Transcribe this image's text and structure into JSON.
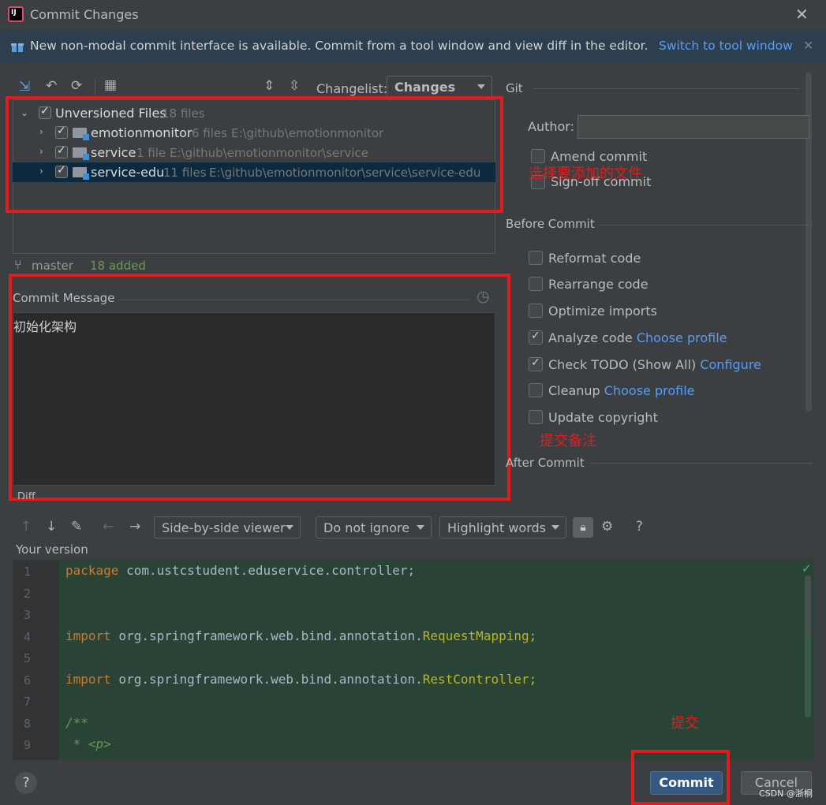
{
  "window": {
    "title": "Commit Changes"
  },
  "banner": {
    "text": "New non-modal commit interface is available. Commit from a tool window and view diff in the editor.",
    "link": "Switch to tool window"
  },
  "toolbar": {
    "changelist_label": "Changelist:",
    "changelist_value": "Changes"
  },
  "tree": {
    "root": {
      "label": "Unversioned Files",
      "count": "18 files"
    },
    "items": [
      {
        "name": "emotionmonitor",
        "count": "6 files",
        "path": "E:\\github\\emotionmonitor"
      },
      {
        "name": "service",
        "count": "1 file",
        "path": "E:\\github\\emotionmonitor\\service"
      },
      {
        "name": "service-edu",
        "count": "11 files",
        "path": "E:\\github\\emotionmonitor\\service\\service-edu"
      }
    ]
  },
  "branch": {
    "name": "master",
    "status": "18 added"
  },
  "commit_message": {
    "label": "Commit Message",
    "value": "初始化架构"
  },
  "diff": {
    "label": "Diff",
    "viewer": "Side-by-side viewer",
    "ignore": "Do not ignore",
    "highlight": "Highlight words",
    "your_version": "Your version",
    "line_numbers": [
      "1",
      "2",
      "3",
      "4",
      "5",
      "6",
      "7",
      "8",
      "9"
    ],
    "lines": [
      {
        "kw": "package",
        "rest": " com.ustcstudent.eduservice.controller;",
        "ann": ""
      },
      {
        "kw": "",
        "rest": "",
        "ann": ""
      },
      {
        "kw": "",
        "rest": "",
        "ann": ""
      },
      {
        "kw": "import",
        "rest": " org.springframework.web.bind.annotation.",
        "ann": "RequestMapping;"
      },
      {
        "kw": "",
        "rest": "",
        "ann": ""
      },
      {
        "kw": "import",
        "rest": " org.springframework.web.bind.annotation.",
        "ann": "RestController;"
      },
      {
        "kw": "",
        "rest": "",
        "ann": ""
      },
      {
        "cmt": "/**"
      },
      {
        "cmt": " * <p>"
      }
    ]
  },
  "git": {
    "label": "Git",
    "author_label": "Author:",
    "author_value": "",
    "amend": "Amend commit",
    "signoff": "Sign-off commit"
  },
  "before_commit": {
    "label": "Before Commit",
    "options": [
      {
        "label": "Reformat code",
        "checked": false,
        "link": ""
      },
      {
        "label": "Rearrange code",
        "checked": false,
        "link": ""
      },
      {
        "label": "Optimize imports",
        "checked": false,
        "link": ""
      },
      {
        "label": "Analyze code",
        "checked": true,
        "link": "Choose profile"
      },
      {
        "label": "Check TODO (Show All)",
        "checked": true,
        "link": "Configure"
      },
      {
        "label": "Cleanup",
        "checked": false,
        "link": "Choose profile"
      },
      {
        "label": "Update copyright",
        "checked": false,
        "link": ""
      }
    ]
  },
  "after_commit": {
    "label": "After Commit"
  },
  "annotations": {
    "select_files": "选择要添加的文件",
    "commit_note": "提交备注",
    "commit": "提交"
  },
  "buttons": {
    "commit": "Commit",
    "cancel": "Cancel",
    "help": "?"
  },
  "watermark": "CSDN @浙桐",
  "colors": {
    "accent": "#589df6",
    "annotation_red": "#e41b1b",
    "primary_button": "#365880"
  }
}
